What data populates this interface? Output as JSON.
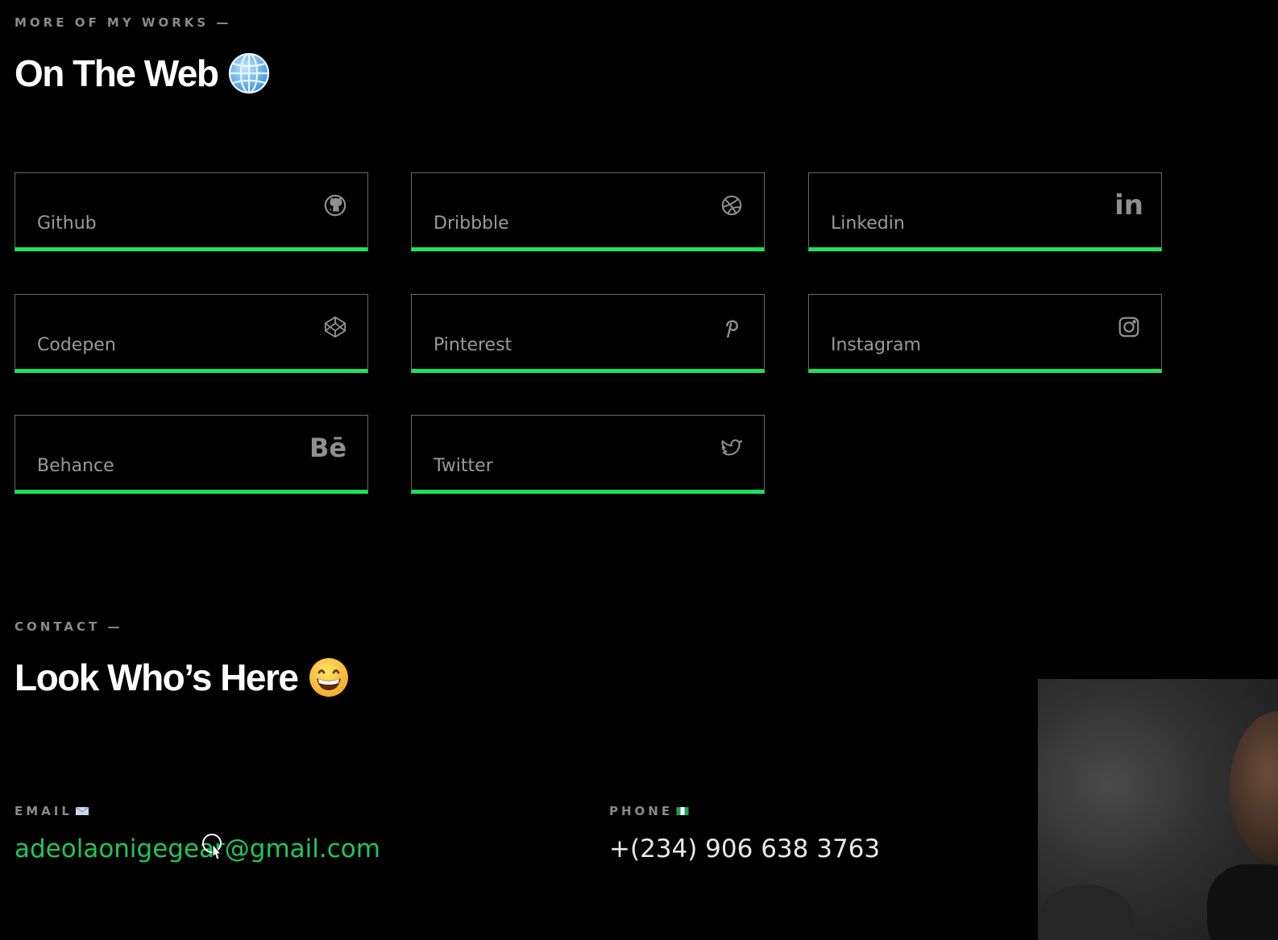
{
  "works": {
    "eyebrow": "MORE OF MY WORKS —",
    "title": "On The Web",
    "title_emoji": "globe-emoji",
    "links": [
      {
        "label": "Github",
        "icon": "github-icon"
      },
      {
        "label": "Dribbble",
        "icon": "dribbble-icon"
      },
      {
        "label": "Linkedin",
        "icon": "linkedin-icon",
        "glyph": "in"
      },
      {
        "label": "Codepen",
        "icon": "codepen-icon"
      },
      {
        "label": "Pinterest",
        "icon": "pinterest-icon"
      },
      {
        "label": "Instagram",
        "icon": "instagram-icon"
      },
      {
        "label": "Behance",
        "icon": "behance-icon",
        "glyph": "Bē"
      },
      {
        "label": "Twitter",
        "icon": "twitter-icon"
      }
    ]
  },
  "contact": {
    "eyebrow": "CONTACT —",
    "title": "Look Who’s Here",
    "title_emoji": "grinning-face-emoji",
    "email_label": "EMAIL",
    "email": "adeolaonigegear@gmail.com",
    "phone_label": "PHONE",
    "phone": "+(234) 906 638 3763"
  },
  "colors": {
    "accent": "#1ee15a",
    "background": "#000000",
    "muted": "#8a8a8a"
  }
}
